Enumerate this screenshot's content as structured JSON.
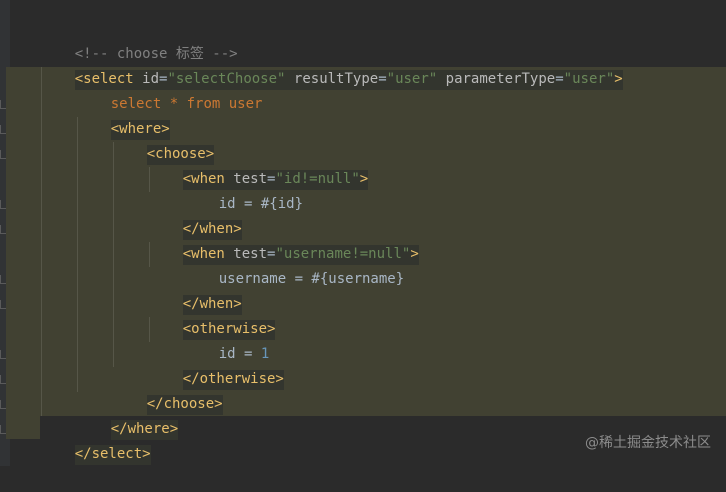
{
  "code": {
    "comment": "<!-- choose 标签 -->",
    "select_open": "<select",
    "attr_id": " id",
    "val_id": "\"selectChoose\"",
    "attr_resultType": " resultType",
    "val_resultType": "\"user\"",
    "attr_parameterType": " parameterType",
    "val_parameterType": "\"user\"",
    "select_open_end": ">",
    "sql_kw1": "select",
    "sql_star": " * ",
    "sql_kw2": "from",
    "sql_table": " user",
    "where_open": "<where>",
    "choose_open": "<choose>",
    "when1_open": "<when",
    "when1_attr": " test",
    "when1_val": "\"id!=null\"",
    "when1_close_bracket": ">",
    "when1_body": "id = #{id}",
    "when1_close": "</when>",
    "when2_open": "<when",
    "when2_attr": " test",
    "when2_val": "\"username!=null\"",
    "when2_close_bracket": ">",
    "when2_body": "username = #{username}",
    "when2_close": "</when>",
    "otherwise_open": "<otherwise>",
    "otherwise_body_prefix": "id = ",
    "otherwise_body_value": "1",
    "otherwise_close": "</otherwise>",
    "choose_close": "</choose>",
    "where_close": "</where>",
    "select_close": "</select>"
  },
  "watermark": "@稀土掘金技术社区",
  "colors": {
    "background": "#2b2b2b",
    "highlight": "#414132",
    "tag": "#e8bf6a",
    "string": "#6a8759",
    "keyword": "#cc7832",
    "comment": "#808080",
    "number": "#6897bb"
  }
}
